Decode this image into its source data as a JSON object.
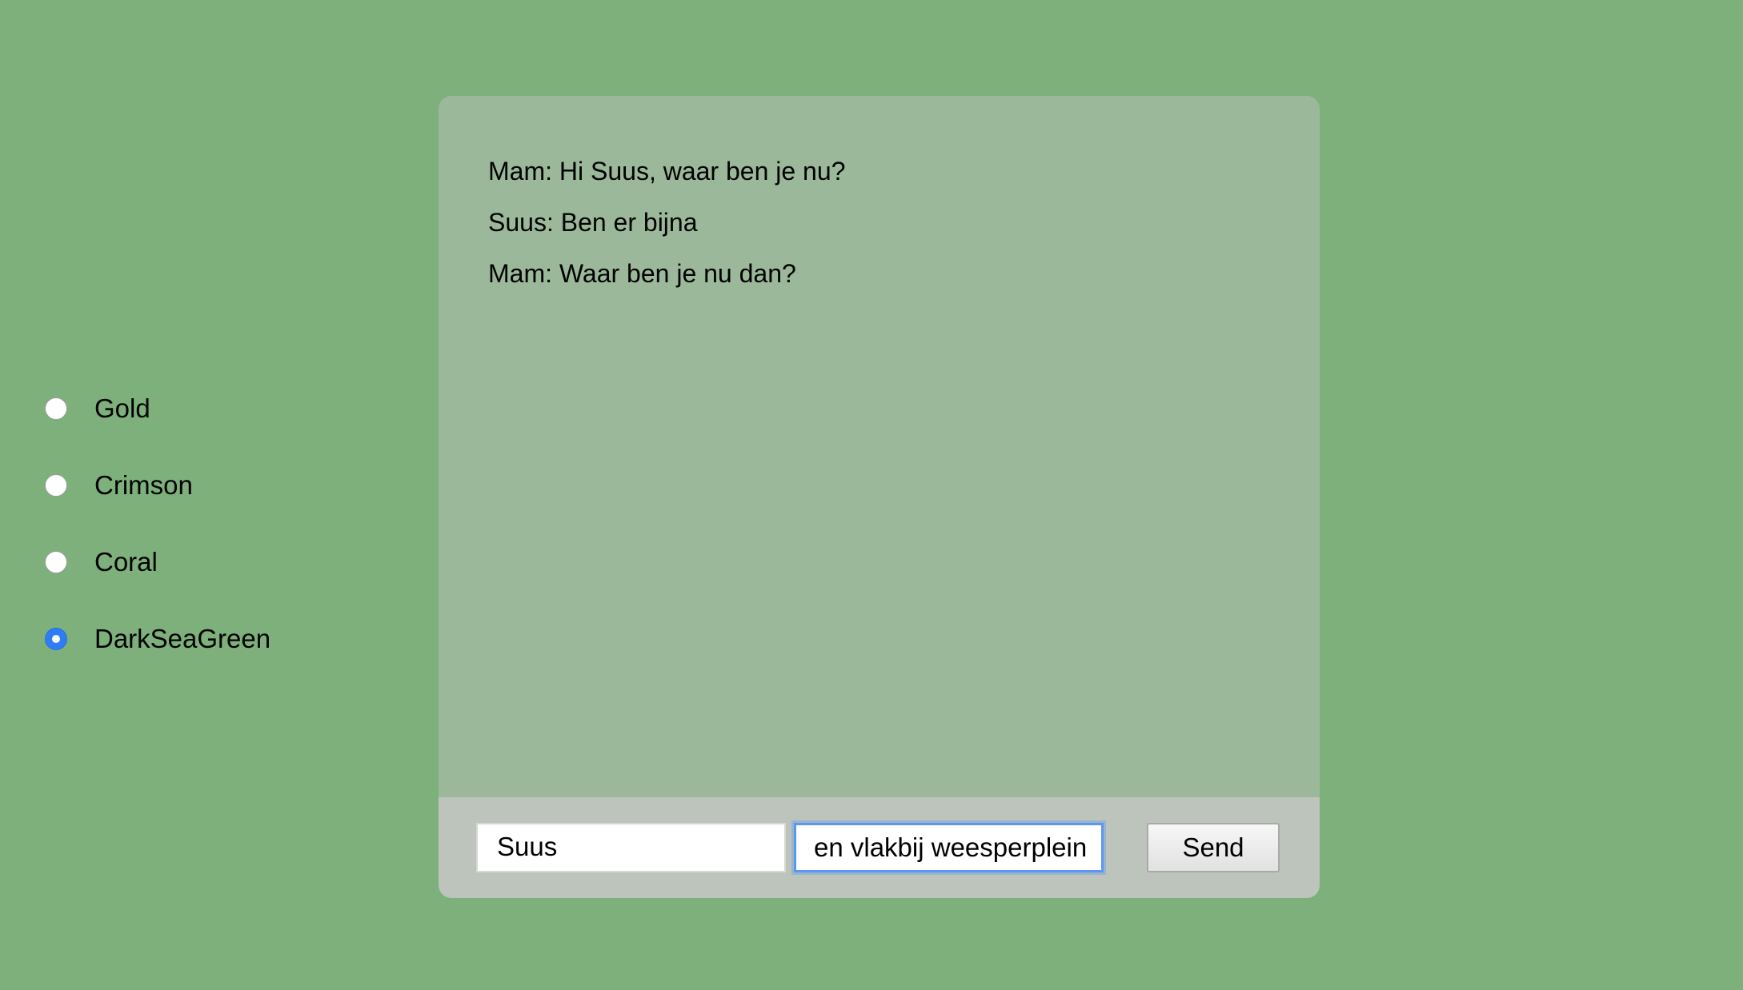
{
  "colors": {
    "page_background": "#7eb07b",
    "chat_background": "#9bb99a",
    "composer_background": "#bcc4bb",
    "radio_selected": "#2f7df6"
  },
  "theme_options": [
    {
      "label": "Gold",
      "selected": false
    },
    {
      "label": "Crimson",
      "selected": false
    },
    {
      "label": "Coral",
      "selected": false
    },
    {
      "label": "DarkSeaGreen",
      "selected": true
    }
  ],
  "chat": {
    "messages": [
      {
        "text": "Mam: Hi Suus, waar ben je nu?"
      },
      {
        "text": "Suus: Ben er bijna"
      },
      {
        "text": "Mam: Waar ben je nu dan?"
      }
    ]
  },
  "composer": {
    "name_value": "Suus",
    "message_value": "en vlakbij weesperplein",
    "send_label": "Send"
  }
}
